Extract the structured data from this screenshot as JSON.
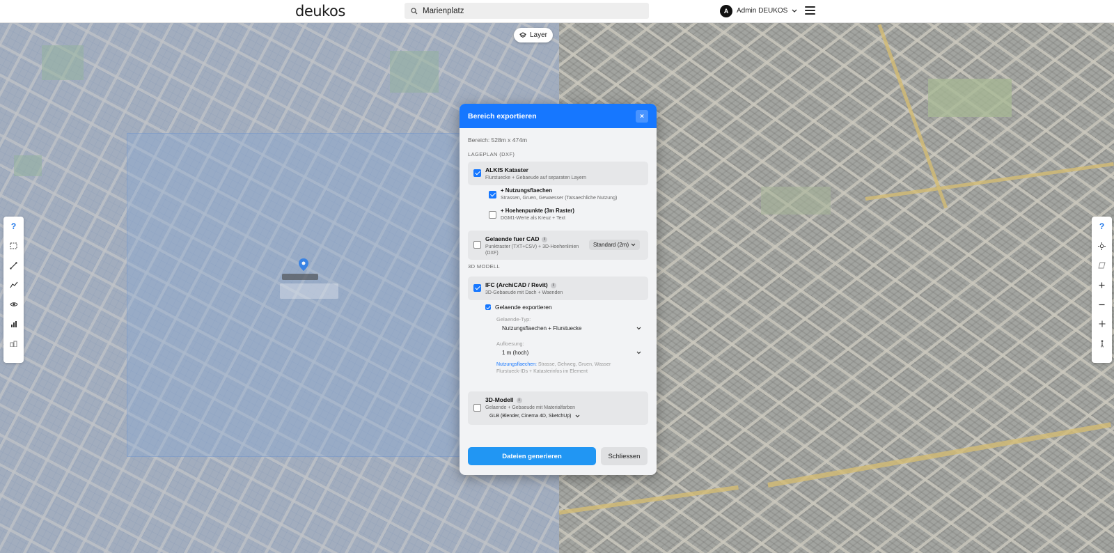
{
  "header": {
    "logo": "deukos",
    "search_value": "Marienplatz",
    "user_initial": "A",
    "user_name": "Admin DEUKOS"
  },
  "map": {
    "layer_button_label": "Layer"
  },
  "left_toolbar": {
    "help_label": "?",
    "icons": [
      "selection-rect-icon",
      "measure-line-icon",
      "elevation-profile-icon",
      "visibility-icon",
      "statistics-icon",
      "buildings-icon"
    ]
  },
  "right_toolbar": {
    "help_label": "?",
    "icons": [
      "sun-icon",
      "layers-3d-icon",
      "zoom-in-icon",
      "zoom-out-icon",
      "navigate-icon",
      "pedestrian-icon"
    ]
  },
  "modal": {
    "title": "Bereich exportieren",
    "close_label": "×",
    "area_label": "Bereich: 528m x 474m",
    "section_lageplan": "LAGEPLAN (DXF)",
    "alkis": {
      "title": "ALKIS Kataster",
      "desc": "Flurstuecke + Gebaeude auf separaten Layern",
      "checked": true
    },
    "nutzung": {
      "title": "+ Nutzungsflaechen",
      "desc": "Strassen, Gruen, Gewaesser (Tatsaechliche Nutzung)",
      "checked": true
    },
    "hoehen": {
      "title": "+ Hoehenpunkte (3m Raster)",
      "desc": "DGM1-Werte als Kreuz + Text",
      "checked": false
    },
    "gelaende_cad": {
      "title": "Gelaende fuer CAD",
      "desc_line1": "Punktraster (TXT+CSV) + 3D-Hoehenlinien",
      "desc_line2": "(DXF)",
      "select_value": "Standard (2m)",
      "checked": false
    },
    "section_3d": "3D MODELL",
    "ifc": {
      "title": "IFC (ArchiCAD / Revit)",
      "desc": "3D-Gebaeude mit Dach + Waenden",
      "checked": true
    },
    "gelaende_export": {
      "title": "Gelaende exportieren",
      "checked": true,
      "type_label": "Gelaende-Typ:",
      "type_value": "Nutzungsflaechen + Flurstuecke",
      "res_label": "Aufloesung:",
      "res_value": "1 m (hoch)",
      "note_link": "Nutzungsflaechen:",
      "note_text": " Strasse, Gehweg, Gruen, Wasser",
      "note_line2": "Flurstueck-IDs + Katasterinfos im Element"
    },
    "model3d": {
      "title": "3D-Modell",
      "desc": "Gelaende + Gebaeude mit Materialfarben",
      "select_value": "GLB (Blender, Cinema 4D, SketchUp)",
      "checked": false
    },
    "generate_label": "Dateien generieren",
    "close_button_label": "Schliessen"
  }
}
